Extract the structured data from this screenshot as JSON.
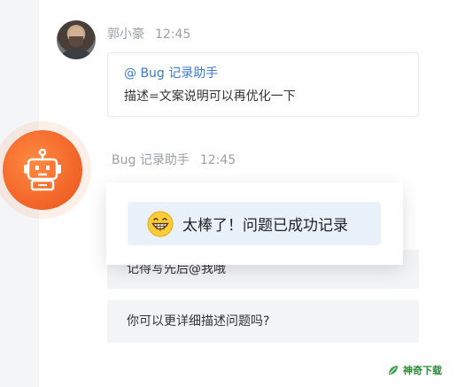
{
  "messages": [
    {
      "sender": "郭小豪",
      "time": "12:45",
      "mention": "@ Bug 记录助手",
      "text": "描述=文案说明可以再优化一下"
    },
    {
      "sender": "Bug 记录助手",
      "time": "12:45"
    }
  ],
  "popup": {
    "emoji": "grinning-face-icon",
    "message": "太棒了！问题已成功记录"
  },
  "rows": [
    {
      "text": "记得写先后@我哦"
    },
    {
      "text": "你可以更详细描述问题吗?"
    }
  ],
  "colors": {
    "accent_orange": "#f05f24",
    "mention_blue": "#3a7bd5",
    "popup_bg": "#e9f1fb"
  },
  "watermark": {
    "text": "神奇下载"
  }
}
